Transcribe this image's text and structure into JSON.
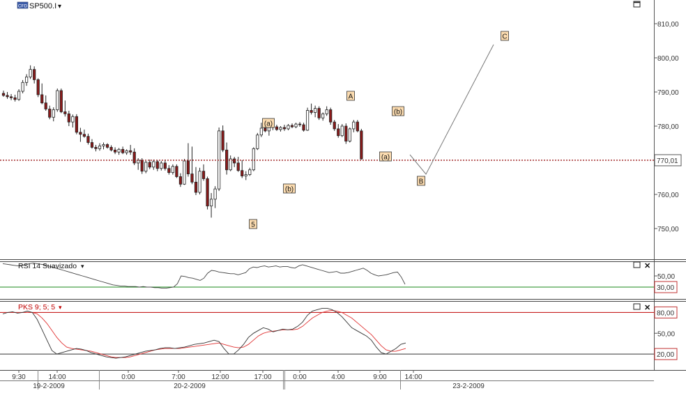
{
  "window": {
    "symbol_badge": "CFD",
    "symbol": "SP500.I",
    "dropdown_glyph": "▾"
  },
  "colors": {
    "up_candle": "#ffffff",
    "down_candle": "#8b1a1a",
    "price_line": "#9b1a1a",
    "label_fill": "#fcdcb0",
    "rsi_low_line": "#1a8a1a",
    "pks_high_line": "#c00000",
    "pks_signal": "#e03030",
    "value_box_red": "#c03030"
  },
  "chart_data": [
    {
      "type": "candlestick",
      "name": "SP500.I",
      "ylim": [
        740,
        815
      ],
      "y_ticks": [
        750,
        760,
        770,
        780,
        790,
        800,
        810
      ],
      "y_tick_labels": [
        "750,00",
        "760,00",
        "770,00",
        "780,00",
        "790,00",
        "800,00",
        "810,00"
      ],
      "current_price": 770.01,
      "current_price_label": "770,01",
      "x_tick_labels": [
        "9:30",
        "14:00",
        "0:00",
        "7:00",
        "12:00",
        "17:00",
        "0:00",
        "4:00",
        "9:00",
        "14:00"
      ],
      "date_labels": [
        "19-2-2009",
        "20-2-2009",
        "23-2-2009"
      ],
      "candles": [
        [
          789.6,
          790.4,
          788.6,
          789.0
        ],
        [
          789.0,
          790.0,
          788.0,
          788.6
        ],
        [
          788.6,
          789.4,
          787.6,
          788.3
        ],
        [
          788.3,
          789.2,
          787.2,
          787.8
        ],
        [
          787.8,
          790.8,
          787.4,
          790.2
        ],
        [
          790.2,
          793.5,
          789.6,
          792.8
        ],
        [
          792.8,
          795.2,
          791.8,
          794.4
        ],
        [
          794.4,
          797.8,
          793.8,
          796.6
        ],
        [
          796.6,
          797.5,
          792.5,
          793.6
        ],
        [
          793.6,
          794.0,
          788.5,
          789.2
        ],
        [
          789.2,
          792.5,
          786.4,
          786.8
        ],
        [
          786.8,
          789.0,
          784.5,
          785.0
        ],
        [
          785.0,
          786.0,
          782.0,
          782.6
        ],
        [
          782.6,
          785.5,
          781.4,
          784.8
        ],
        [
          784.8,
          791.0,
          784.2,
          790.4
        ],
        [
          790.4,
          791.0,
          783.8,
          784.2
        ],
        [
          784.2,
          787.5,
          782.8,
          783.6
        ],
        [
          783.6,
          784.5,
          780.0,
          781.2
        ],
        [
          781.2,
          783.4,
          779.6,
          782.8
        ],
        [
          782.8,
          783.5,
          777.6,
          778.2
        ],
        [
          778.2,
          779.5,
          775.4,
          777.6
        ],
        [
          777.6,
          779.0,
          776.6,
          777.0
        ],
        [
          777.0,
          777.8,
          774.6,
          775.2
        ],
        [
          775.2,
          776.2,
          773.4,
          773.8
        ],
        [
          773.8,
          774.5,
          772.6,
          773.4
        ],
        [
          773.4,
          775.0,
          772.8,
          774.2
        ],
        [
          774.2,
          775.2,
          773.2,
          774.6
        ],
        [
          774.6,
          775.0,
          773.4,
          773.8
        ],
        [
          773.8,
          774.4,
          772.6,
          773.0
        ],
        [
          773.0,
          773.8,
          771.8,
          772.4
        ],
        [
          772.4,
          773.6,
          771.6,
          773.2
        ],
        [
          773.2,
          774.0,
          771.8,
          772.2
        ],
        [
          772.2,
          773.2,
          771.6,
          772.8
        ],
        [
          772.8,
          774.5,
          771.6,
          772.4
        ],
        [
          772.4,
          773.5,
          768.6,
          769.2
        ],
        [
          769.2,
          770.6,
          767.2,
          770.0
        ],
        [
          770.0,
          770.6,
          766.0,
          766.8
        ],
        [
          766.8,
          769.8,
          766.2,
          769.4
        ],
        [
          769.4,
          770.2,
          767.4,
          768.0
        ],
        [
          768.0,
          770.2,
          767.2,
          769.6
        ],
        [
          769.6,
          770.0,
          766.8,
          767.6
        ],
        [
          767.6,
          769.8,
          767.0,
          769.2
        ],
        [
          769.2,
          770.2,
          767.0,
          767.6
        ],
        [
          767.6,
          768.6,
          765.8,
          766.4
        ],
        [
          766.4,
          768.8,
          765.8,
          768.2
        ],
        [
          768.2,
          768.8,
          764.8,
          765.2
        ],
        [
          765.2,
          766.2,
          762.2,
          763.0
        ],
        [
          763.0,
          770.4,
          762.8,
          769.8
        ],
        [
          769.8,
          775.0,
          765.2,
          766.0
        ],
        [
          766.0,
          774.0,
          763.0,
          763.6
        ],
        [
          763.6,
          768.0,
          759.8,
          760.6
        ],
        [
          760.6,
          767.8,
          760.0,
          766.8
        ],
        [
          766.8,
          768.8,
          764.0,
          764.6
        ],
        [
          764.6,
          765.2,
          755.6,
          756.6
        ],
        [
          756.6,
          760.4,
          753.2,
          758.6
        ],
        [
          758.6,
          762.4,
          756.0,
          761.6
        ],
        [
          761.6,
          779.6,
          761.0,
          778.6
        ],
        [
          778.6,
          780.2,
          772.4,
          773.0
        ],
        [
          773.0,
          775.2,
          765.8,
          767.2
        ],
        [
          767.2,
          771.4,
          766.8,
          770.4
        ],
        [
          770.4,
          771.0,
          768.0,
          769.2
        ],
        [
          769.2,
          771.0,
          766.6,
          767.0
        ],
        [
          767.0,
          770.0,
          764.8,
          765.4
        ],
        [
          765.4,
          766.8,
          764.2,
          765.8
        ],
        [
          765.8,
          767.8,
          765.4,
          767.2
        ],
        [
          767.2,
          773.8,
          766.8,
          773.4
        ],
        [
          773.4,
          778.0,
          773.0,
          777.4
        ],
        [
          777.4,
          781.0,
          776.8,
          779.4
        ],
        [
          779.4,
          780.5,
          778.2,
          778.6
        ],
        [
          778.6,
          780.0,
          777.2,
          779.6
        ],
        [
          779.6,
          780.8,
          778.8,
          779.8
        ],
        [
          779.8,
          780.4,
          778.6,
          779.0
        ],
        [
          779.0,
          780.0,
          778.4,
          779.6
        ],
        [
          779.6,
          780.4,
          778.6,
          779.2
        ],
        [
          779.2,
          780.6,
          778.8,
          780.2
        ],
        [
          780.2,
          780.8,
          779.4,
          779.8
        ],
        [
          779.8,
          781.0,
          779.4,
          780.6
        ],
        [
          780.6,
          781.2,
          779.8,
          780.4
        ],
        [
          780.4,
          781.0,
          778.4,
          778.8
        ],
        [
          778.8,
          785.4,
          778.6,
          784.6
        ],
        [
          784.6,
          786.6,
          783.4,
          784.0
        ],
        [
          784.0,
          786.0,
          782.6,
          785.2
        ],
        [
          785.2,
          785.8,
          781.8,
          782.4
        ],
        [
          782.4,
          784.0,
          781.6,
          783.6
        ],
        [
          783.6,
          785.8,
          783.0,
          784.8
        ],
        [
          784.8,
          785.4,
          780.4,
          781.2
        ],
        [
          781.2,
          781.8,
          778.6,
          779.2
        ],
        [
          779.2,
          780.6,
          776.6,
          777.2
        ],
        [
          777.2,
          780.6,
          776.8,
          780.0
        ],
        [
          780.0,
          780.8,
          774.8,
          775.6
        ],
        [
          775.6,
          779.6,
          775.2,
          779.2
        ],
        [
          779.2,
          781.8,
          778.2,
          781.2
        ],
        [
          781.2,
          781.8,
          778.2,
          778.6
        ],
        [
          778.6,
          779.2,
          770.2,
          770.4
        ]
      ]
    },
    {
      "type": "line",
      "name": "RSI 14 Suavizado",
      "ylim": [
        15,
        75
      ],
      "y_ticks": [
        50
      ],
      "y_tick_labels": [
        "50,00"
      ],
      "reference_level": 30,
      "reference_label": "30,00",
      "series": [
        {
          "values": [
            72,
            71,
            70,
            69,
            68,
            69,
            70,
            72,
            73,
            72,
            71,
            70,
            68,
            66,
            64,
            62,
            60,
            58,
            56,
            54,
            52,
            50,
            48,
            46,
            44,
            42,
            40,
            38,
            36,
            34,
            33,
            32,
            32,
            31,
            31,
            31,
            30,
            31,
            30,
            30,
            29,
            29,
            28,
            28,
            29,
            30,
            36,
            50,
            49,
            47,
            46,
            44,
            42,
            46,
            55,
            60,
            59,
            57,
            56,
            55,
            54,
            54,
            52,
            54,
            56,
            63,
            66,
            65,
            67,
            68,
            66,
            67,
            68,
            66,
            67,
            67,
            65,
            64,
            68,
            70,
            68,
            66,
            64,
            62,
            60,
            58,
            56,
            57,
            58,
            55,
            55,
            56,
            58,
            60,
            62,
            64,
            60,
            55,
            52,
            50,
            51,
            52,
            54,
            56,
            57,
            48,
            35
          ]
        }
      ]
    },
    {
      "type": "line",
      "name": "PKS 9; 5; 5",
      "ylim": [
        0,
        100
      ],
      "y_ticks": [
        50
      ],
      "y_tick_labels": [
        "50,00"
      ],
      "reference_levels": [
        20,
        80
      ],
      "reference_labels": [
        "20,00",
        "80,00"
      ],
      "series": [
        {
          "name": "PKS",
          "values": [
            78,
            80,
            81,
            79,
            80,
            82,
            80,
            70,
            55,
            40,
            25,
            20,
            22,
            24,
            26,
            28,
            27,
            25,
            22,
            20,
            18,
            16,
            15,
            14,
            15,
            16,
            18,
            20,
            22,
            24,
            25,
            26,
            28,
            29,
            29,
            28,
            29,
            30,
            32,
            34,
            35,
            36,
            38,
            40,
            38,
            28,
            20,
            20,
            26,
            34,
            44,
            50,
            54,
            58,
            56,
            52,
            54,
            56,
            55,
            56,
            60,
            66,
            76,
            82,
            84,
            86,
            86,
            84,
            80,
            74,
            66,
            58,
            54,
            50,
            46,
            40,
            30,
            22,
            20,
            24,
            28,
            34,
            36
          ]
        },
        {
          "name": "Signal",
          "values": [
            80,
            80,
            80,
            80,
            80,
            80,
            80,
            78,
            72,
            64,
            54,
            44,
            36,
            30,
            28,
            27,
            26,
            25,
            24,
            22,
            20,
            18,
            16,
            15,
            15,
            15,
            16,
            18,
            20,
            22,
            24,
            26,
            27,
            28,
            28,
            28,
            28,
            29,
            30,
            31,
            32,
            33,
            34,
            35,
            36,
            34,
            32,
            30,
            29,
            30,
            34,
            40,
            46,
            50,
            52,
            53,
            54,
            55,
            55,
            55,
            56,
            60,
            66,
            72,
            76,
            80,
            82,
            83,
            82,
            80,
            76,
            72,
            66,
            60,
            54,
            48,
            40,
            32,
            26,
            24,
            24,
            26,
            28
          ]
        }
      ]
    }
  ],
  "wave_labels": [
    "5",
    "(a)",
    "(b)",
    "A",
    "(b)",
    "(a)",
    "B",
    "C"
  ],
  "rsi_panel": {
    "title": "RSI 14 Suavizado"
  },
  "pks_panel": {
    "title": "PKS 9; 5; 5"
  }
}
